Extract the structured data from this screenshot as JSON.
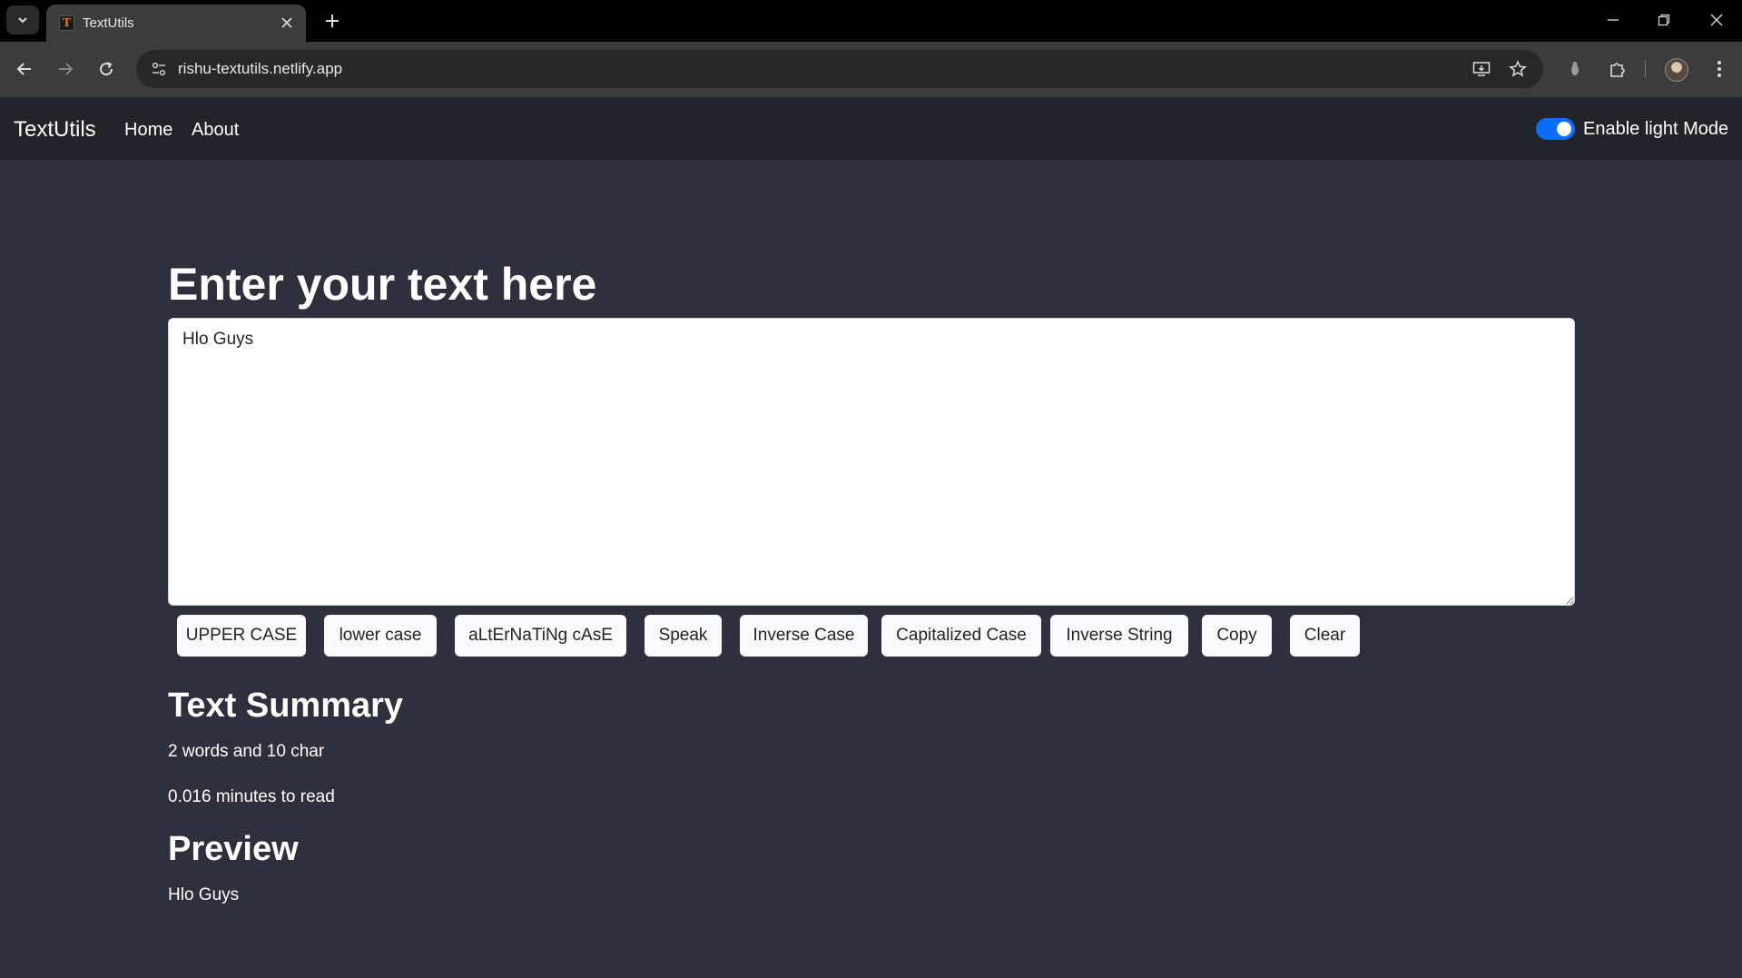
{
  "browser": {
    "tab_title": "TextUtils",
    "favicon_letter": "T",
    "url": "rishu-textutils.netlify.app",
    "icons": {
      "tab_list": "chevron-down-icon",
      "tab_close": "close-icon",
      "new_tab": "plus-icon",
      "minimize": "minimize-icon",
      "restore": "restore-icon",
      "close_window": "close-icon",
      "back": "back-arrow-icon",
      "forward": "forward-arrow-icon",
      "reload": "reload-icon",
      "site_info": "tune-icon",
      "install": "install-app-icon",
      "bookmark": "star-icon",
      "extension_pin": "extension-icon",
      "extensions": "puzzle-icon",
      "profile": "avatar",
      "menu": "kebab-menu-icon"
    }
  },
  "navbar": {
    "brand": "TextUtils",
    "links": [
      "Home",
      "About"
    ],
    "mode_toggle_label": "Enable light Mode",
    "mode_toggle_on": true,
    "accent_color": "#0d6efd"
  },
  "main": {
    "heading": "Enter your text here",
    "textarea_value": "Hlo Guys",
    "buttons": [
      "UPPER CASE",
      "lower case",
      "aLtErNaTiNg cAsE",
      "Speak",
      "Inverse Case",
      "Capitalized Case",
      "Inverse String",
      "Copy",
      "Clear"
    ]
  },
  "summary": {
    "heading": "Text Summary",
    "counts": "2 words and 10 char",
    "read_time": "0.016 minutes to read"
  },
  "preview": {
    "heading": "Preview",
    "text": "Hlo Guys"
  },
  "colors": {
    "page_background": "#302f3d",
    "navbar_background": "#212529",
    "button_background": "#f8f9fa"
  }
}
